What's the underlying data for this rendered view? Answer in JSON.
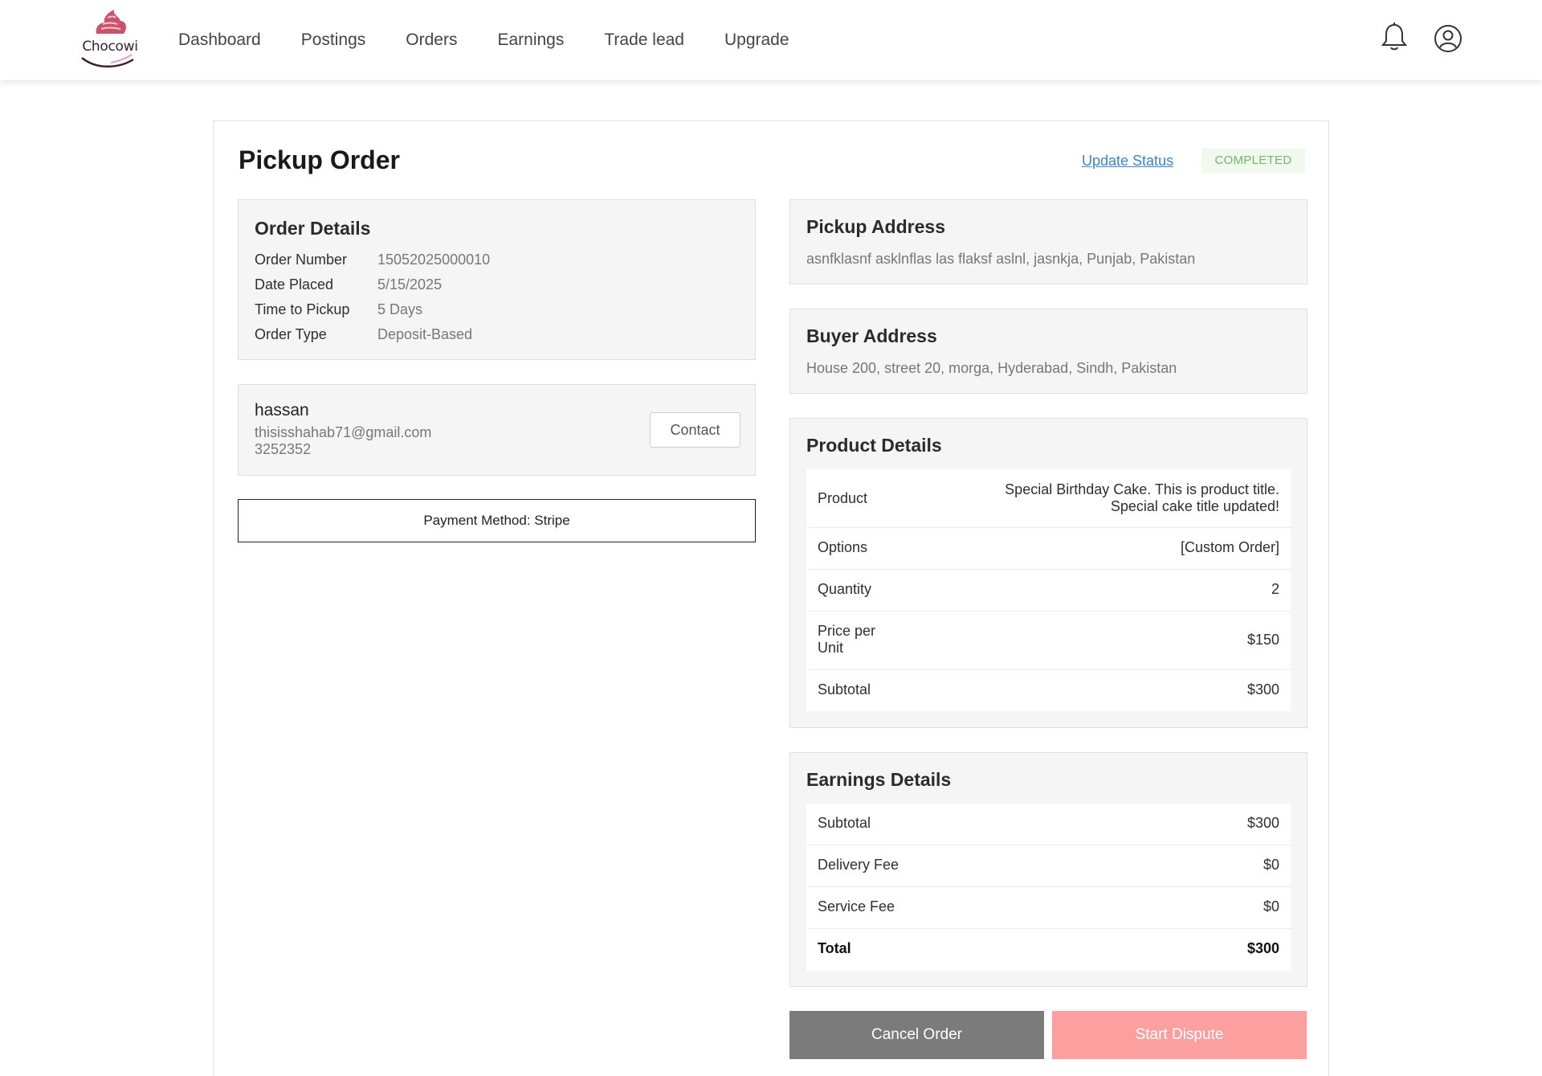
{
  "brand": {
    "name": "Chocowi",
    "logo_icon": "cupcake-logo"
  },
  "nav": {
    "items": [
      {
        "label": "Dashboard"
      },
      {
        "label": "Postings"
      },
      {
        "label": "Orders"
      },
      {
        "label": "Earnings"
      },
      {
        "label": "Trade lead"
      },
      {
        "label": "Upgrade"
      }
    ],
    "icons": {
      "notifications": "bell-icon",
      "account": "user-circle-icon"
    }
  },
  "page": {
    "title": "Pickup Order",
    "update_status_label": "Update Status",
    "status": "COMPLETED",
    "status_color": "#72b86a"
  },
  "order_details": {
    "title": "Order Details",
    "rows": [
      {
        "label": "Order Number",
        "value": "15052025000010"
      },
      {
        "label": "Date Placed",
        "value": "5/15/2025"
      },
      {
        "label": "Time to Pickup",
        "value": "5 Days"
      },
      {
        "label": "Order Type",
        "value": "Deposit-Based"
      }
    ]
  },
  "buyer": {
    "name": "hassan",
    "email": "thisisshahab71@gmail.com",
    "phone": "3252352",
    "contact_label": "Contact"
  },
  "payment": {
    "label": "Payment Method: Stripe"
  },
  "pickup_address": {
    "title": "Pickup Address",
    "text": "asnfklasnf asklnflas las flaksf aslnl, jasnkja, Punjab, Pakistan"
  },
  "buyer_address": {
    "title": "Buyer Address",
    "text": "House 200, street 20, morga, Hyderabad, Sindh, Pakistan"
  },
  "product_details": {
    "title": "Product Details",
    "product_label": "Product",
    "product_value_line1": "Special Birthday Cake. This is product title.",
    "product_value_line2": "Special cake title updated!",
    "options_label": "Options",
    "options_value": "[Custom Order]",
    "quantity_label": "Quantity",
    "quantity_value": "2",
    "price_label_line1": "Price per",
    "price_label_line2": "Unit",
    "price_value": "$150",
    "subtotal_label": "Subtotal",
    "subtotal_value": "$300"
  },
  "earnings_details": {
    "title": "Earnings Details",
    "rows": [
      {
        "label": "Subtotal",
        "value": "$300"
      },
      {
        "label": "Delivery Fee",
        "value": "$0"
      },
      {
        "label": "Service Fee",
        "value": "$0"
      },
      {
        "label": "Total",
        "value": "$300"
      }
    ]
  },
  "actions": {
    "cancel_label": "Cancel Order",
    "dispute_label": "Start Dispute",
    "cancel_color": "#7b7b7b",
    "dispute_color": "#fc9f9f"
  }
}
